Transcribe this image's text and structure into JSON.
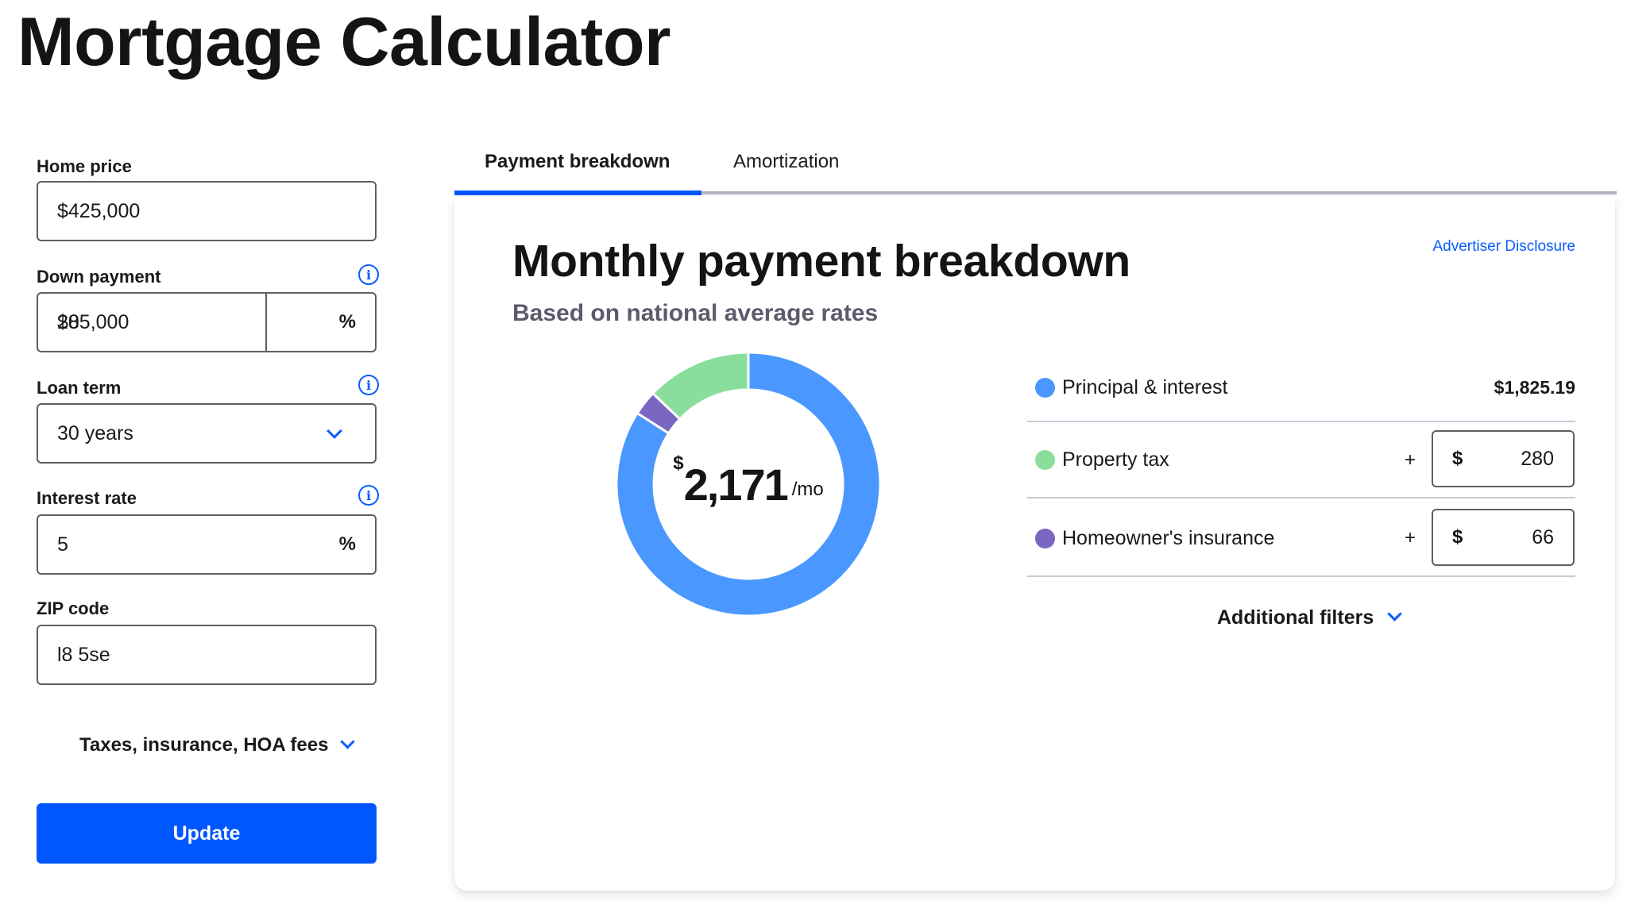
{
  "page": {
    "title": "Mortgage Calculator"
  },
  "form": {
    "home_price": {
      "label": "Home price",
      "value": "$425,000"
    },
    "down_payment": {
      "label": "Down payment",
      "value": "$85,000",
      "percent": "20",
      "percent_suffix": "%"
    },
    "loan_term": {
      "label": "Loan term",
      "value": "30 years"
    },
    "interest_rate": {
      "label": "Interest rate",
      "value": "5",
      "suffix": "%"
    },
    "zip_code": {
      "label": "ZIP code",
      "value": "l8 5se"
    },
    "taxes_toggle": "Taxes, insurance, HOA fees",
    "update_button": "Update",
    "info_glyph": "i"
  },
  "tabs": [
    {
      "label": "Payment breakdown",
      "active": true
    },
    {
      "label": "Amortization",
      "active": false
    }
  ],
  "card": {
    "title": "Monthly payment breakdown",
    "subtitle": "Based on national average rates",
    "advertiser_disclosure": "Advertiser Disclosure",
    "total": {
      "currency": "$",
      "amount": "2,171",
      "period": "/mo"
    },
    "breakdown": {
      "principal_interest": {
        "label": "Principal & interest",
        "value": "$1,825.19"
      },
      "property_tax": {
        "label": "Property tax",
        "plus": "+",
        "currency": "$",
        "value": "280"
      },
      "home_insurance": {
        "label": "Homeowner's insurance",
        "plus": "+",
        "currency": "$",
        "value": "66"
      }
    },
    "additional_filters": "Additional filters"
  },
  "colors": {
    "accent": "#0157ff",
    "principal": "#4a98ff",
    "tax": "#8ade9c",
    "insurance": "#7b66c2"
  },
  "chart_data": {
    "type": "pie",
    "variant": "donut",
    "title": "",
    "center_label": "$2,171 /mo",
    "order": "clockwise-from-top",
    "slices": [
      {
        "name": "Principal & interest",
        "value": 1825.19,
        "color": "#4a98ff"
      },
      {
        "name": "Homeowner's insurance",
        "value": 66,
        "color": "#7b66c2"
      },
      {
        "name": "Property tax",
        "value": 280,
        "color": "#8ade9c"
      }
    ]
  }
}
